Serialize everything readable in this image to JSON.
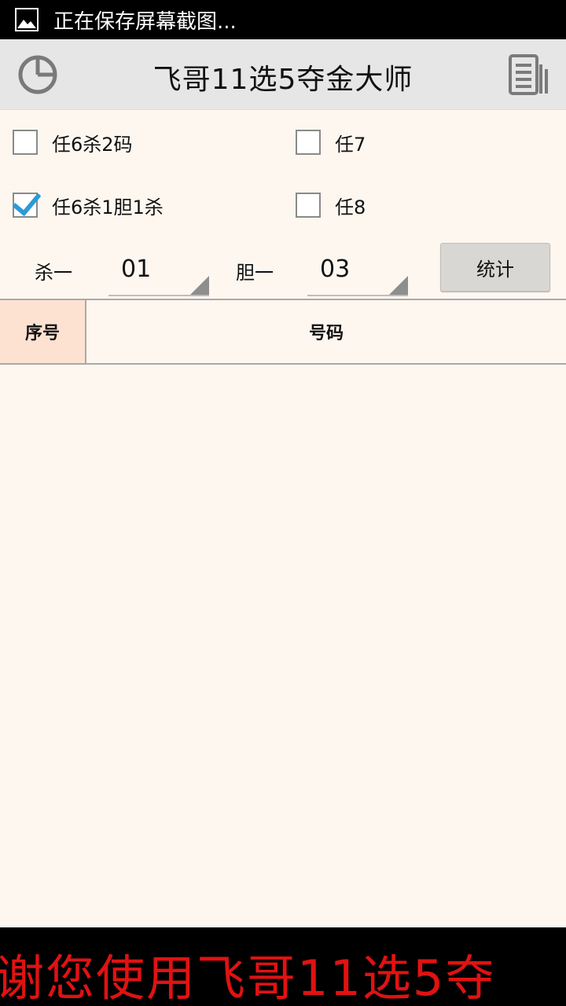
{
  "status_bar": {
    "icon": "image-icon",
    "text": "正在保存屏幕截图..."
  },
  "title_bar": {
    "title": "飞哥11选5夺金大师",
    "left_icon": "pie-chart-icon",
    "right_icon": "document-list-icon"
  },
  "options": [
    {
      "label": "任6杀2码",
      "checked": false
    },
    {
      "label": "任7",
      "checked": false
    },
    {
      "label": "任6杀1胆1杀",
      "checked": true
    },
    {
      "label": "任8",
      "checked": false
    }
  ],
  "selectors": {
    "kill_label": "杀一",
    "kill_value": "01",
    "bold_label": "胆一",
    "bold_value": "03",
    "stat_button": "统计"
  },
  "table": {
    "headers": [
      "序号",
      "号码"
    ],
    "rows": []
  },
  "banner": {
    "text": "谢您使用飞哥11选5夺"
  },
  "colors": {
    "background": "#fdf7f0",
    "title_bar": "#e6e6e6",
    "checkbox_check": "#2d9ad6",
    "seq_header": "#fde2d2",
    "banner_text": "#e01212"
  }
}
